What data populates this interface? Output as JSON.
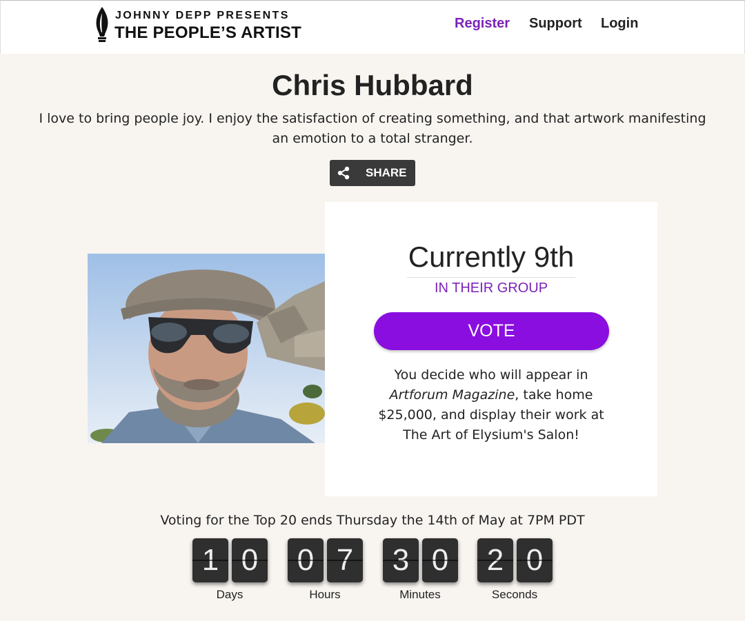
{
  "header": {
    "logo_line1": "JOHNNY DEPP PRESENTS",
    "logo_line2": "THE PEOPLE’S ARTIST",
    "nav": {
      "register": "Register",
      "support": "Support",
      "login": "Login"
    },
    "accent_color": "#7a22b8"
  },
  "artist": {
    "name": "Chris Hubbard",
    "bio": "I love to bring people joy. I enjoy the satisfaction of creating something, and that artwork manifesting an emotion to a total stranger.",
    "share_label": "SHARE"
  },
  "vote_card": {
    "rank": "Currently 9th",
    "group_label": "IN THEIR GROUP",
    "vote_label": "VOTE",
    "vote_button_color": "#8a0ee0",
    "desc_part1": "You decide who will appear in",
    "desc_italic": "Artforum Magazine",
    "desc_part2": ", take home $25,000, and display their work at The Art of Elysium's Salon!"
  },
  "countdown": {
    "deadline_text": "Voting for the Top 20 ends Thursday the 14th of May at 7PM PDT",
    "units": [
      {
        "label": "Days",
        "digits": [
          "1",
          "0"
        ]
      },
      {
        "label": "Hours",
        "digits": [
          "0",
          "7"
        ]
      },
      {
        "label": "Minutes",
        "digits": [
          "3",
          "0"
        ]
      },
      {
        "label": "Seconds",
        "digits": [
          "2",
          "0"
        ]
      }
    ]
  }
}
